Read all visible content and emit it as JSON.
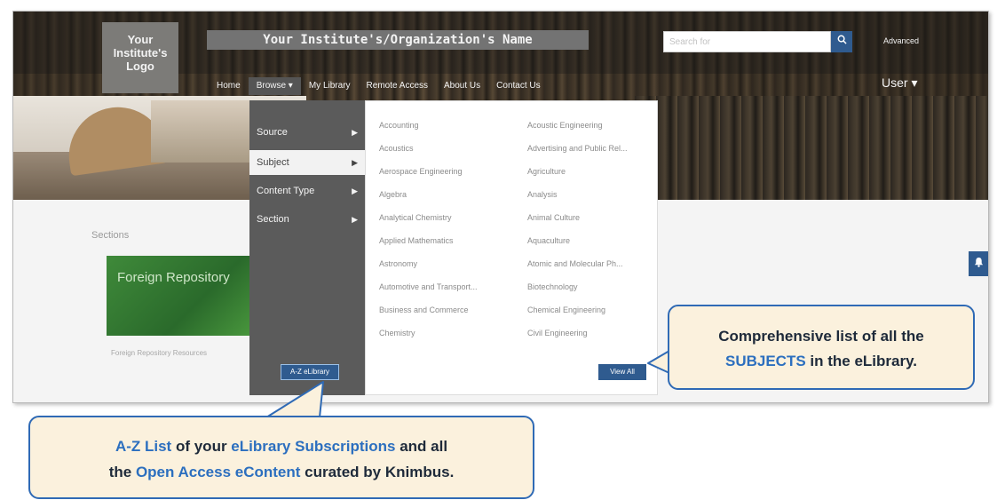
{
  "header": {
    "logo_text": "Your Institute's Logo",
    "org_name": "Your Institute's/Organization's Name",
    "search_placeholder": "Search for",
    "search_icon": "search-icon",
    "advanced_label": "Advanced",
    "user_label": "User ▾"
  },
  "nav": {
    "items": [
      "Home",
      "Browse ▾",
      "My Library",
      "Remote Access",
      "About Us",
      "Contact Us"
    ],
    "active_index": 1
  },
  "browse_menu": {
    "categories": [
      {
        "label": "Source",
        "arrow": "▶"
      },
      {
        "label": "Subject",
        "arrow": "▶"
      },
      {
        "label": "Content Type",
        "arrow": "▶"
      },
      {
        "label": "Section",
        "arrow": "▶"
      }
    ],
    "selected_index": 1,
    "az_button": "A-Z eLibrary",
    "view_all": "View All"
  },
  "subjects": {
    "col1": [
      "Accounting",
      "Acoustics",
      "Aerospace Engineering",
      "Algebra",
      "Analytical Chemistry",
      "Applied Mathematics",
      "Astronomy",
      "Automotive and Transport...",
      "Business and Commerce",
      "Chemistry"
    ],
    "col2": [
      "Acoustic Engineering",
      "Advertising and Public Rel...",
      "Agriculture",
      "Analysis",
      "Animal Culture",
      "Aquaculture",
      "Atomic and Molecular Ph...",
      "Biotechnology",
      "Chemical Engineering",
      "Civil Engineering"
    ]
  },
  "page": {
    "sections_label": "Sections",
    "card_title": "Foreign Repository",
    "card_caption": "Foreign Repository Resources",
    "bell_icon": "bell-icon"
  },
  "callouts": {
    "subjects": {
      "line1": "Comprehensive list of all the",
      "hl": "SUBJECTS",
      "line2_rest": " in the eLibrary."
    },
    "az": {
      "hl1": "A-Z List",
      "t1": " of your ",
      "hl2": "eLibrary Subscriptions",
      "t2": " and all",
      "t3": "the ",
      "hl3": "Open Access eContent",
      "t4": " curated by Knimbus."
    }
  },
  "colors": {
    "accent_blue": "#2f5b8f",
    "callout_bg": "#fbf1dd",
    "callout_border": "#2f6ab5",
    "highlight_text": "#2c6fbf"
  }
}
